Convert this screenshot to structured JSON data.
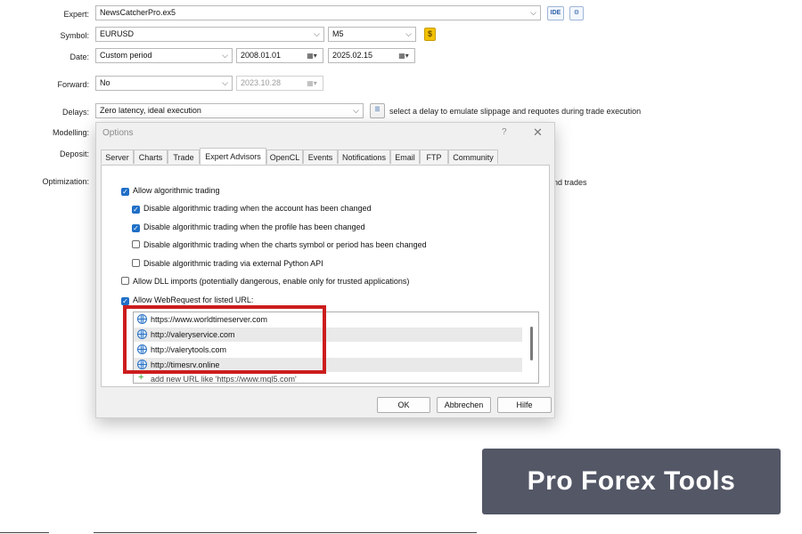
{
  "tester": {
    "expert_label": "Expert:",
    "expert_value": "NewsCatcherPro.ex5",
    "ide_label": "IDE",
    "symbol_label": "Symbol:",
    "symbol_value": "EURUSD",
    "timeframe_value": "M5",
    "coin_symbol": "$",
    "date_label": "Date:",
    "date_mode": "Custom period",
    "date_from": "2008.01.01",
    "date_to": "2025.02.15",
    "forward_label": "Forward:",
    "forward_value": "No",
    "forward_date": "2023.10.28",
    "delays_label": "Delays:",
    "delays_value": "Zero latency, ideal execution",
    "delays_hint": "select a delay to emulate slippage and requotes during trade execution",
    "modelling_label": "Modelling:",
    "deposit_label": "Deposit:",
    "optimization_label": "Optimization:",
    "optimization_tail": "nd trades"
  },
  "dialog": {
    "title": "Options",
    "help": "?",
    "close": "✕",
    "tabs": [
      "Server",
      "Charts",
      "Trade",
      "Expert Advisors",
      "OpenCL",
      "Events",
      "Notifications",
      "Email",
      "FTP",
      "Community"
    ],
    "active_tab": "Expert Advisors",
    "checks": [
      {
        "label": "Allow algorithmic trading",
        "checked": true
      },
      {
        "label": "Disable algorithmic trading when the account has been changed",
        "checked": true
      },
      {
        "label": "Disable algorithmic trading when the profile has been changed",
        "checked": true
      },
      {
        "label": "Disable algorithmic trading when the charts symbol or period has been changed",
        "checked": false
      },
      {
        "label": "Disable algorithmic trading via external Python API",
        "checked": false
      },
      {
        "label": "Allow DLL imports (potentially dangerous, enable only for trusted applications)",
        "checked": false
      },
      {
        "label": "Allow WebRequest for listed URL:",
        "checked": true
      }
    ],
    "urls": [
      "https://www.worldtimeserver.com",
      "http://valeryservice.com",
      "http://valerytools.com",
      "http://timesrv.online"
    ],
    "add_url": "add new URL like 'https://www.mql5.com'",
    "buttons": {
      "ok": "OK",
      "cancel": "Abbrechen",
      "help": "Hilfe"
    }
  },
  "watermark": "Pro Forex Tools",
  "colors": {
    "highlight": "#cc1d1d",
    "checkbox": "#1f6fc6",
    "brand_bg": "#535766"
  },
  "icons": [
    "chevron-down-icon",
    "calendar-icon",
    "gear-icon",
    "coin-icon",
    "settings-sliders-icon",
    "globe-icon",
    "plus-icon",
    "close-icon"
  ]
}
